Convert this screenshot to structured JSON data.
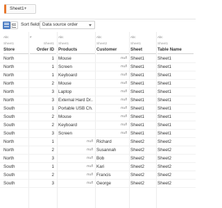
{
  "sheet_tab": {
    "label": "Sheet1+"
  },
  "toolbar": {
    "sort_label": "Sort fields",
    "sort_value": "Data source order"
  },
  "columns": [
    {
      "type_icon": "Abc",
      "source": "Sheet1",
      "name": "Store",
      "align": "left"
    },
    {
      "type_icon": "#",
      "source": "Sheet1",
      "name": "Order ID",
      "align": "right"
    },
    {
      "type_icon": "Abc",
      "source": "Sheet1",
      "name": "Products",
      "align": "left"
    },
    {
      "type_icon": "Abc",
      "source": "Sheet2",
      "name": "Customer",
      "align": "left"
    },
    {
      "type_icon": "Abc",
      "source": "Sheet1",
      "name": "Sheet",
      "align": "left"
    },
    {
      "type_icon": "Abc",
      "source": "Sheet1",
      "name": "Table Name",
      "align": "left"
    }
  ],
  "rows": [
    [
      "North",
      "1",
      "Mouse",
      "null",
      "Sheet1",
      "Sheet1"
    ],
    [
      "North",
      "1",
      "Screen",
      "null",
      "Sheet1",
      "Sheet1"
    ],
    [
      "North",
      "1",
      "Keyboard",
      "null",
      "Sheet1",
      "Sheet1"
    ],
    [
      "North",
      "2",
      "Mouse",
      "null",
      "Sheet1",
      "Sheet1"
    ],
    [
      "North",
      "3",
      "Laptop",
      "null",
      "Sheet1",
      "Sheet1"
    ],
    [
      "North",
      "3",
      "External Hard Dr...",
      "null",
      "Sheet1",
      "Sheet1"
    ],
    [
      "South",
      "1",
      "Portable USB Ch...",
      "null",
      "Sheet1",
      "Sheet1"
    ],
    [
      "South",
      "2",
      "Mouse",
      "null",
      "Sheet1",
      "Sheet1"
    ],
    [
      "South",
      "2",
      "Keyboard",
      "null",
      "Sheet1",
      "Sheet1"
    ],
    [
      "South",
      "3",
      "Screen",
      "null",
      "Sheet1",
      "Sheet1"
    ],
    [
      "North",
      "1",
      "null",
      "Richard",
      "Sheet2",
      "Sheet2"
    ],
    [
      "North",
      "2",
      "null",
      "Susannah",
      "Sheet2",
      "Sheet2"
    ],
    [
      "North",
      "3",
      "null",
      "Bob",
      "Sheet2",
      "Sheet2"
    ],
    [
      "South",
      "1",
      "null",
      "Kari",
      "Sheet2",
      "Sheet2"
    ],
    [
      "South",
      "2",
      "null",
      "Francis",
      "Sheet2",
      "Sheet2"
    ],
    [
      "South",
      "3",
      "null",
      "George",
      "Sheet2",
      "Sheet2"
    ]
  ]
}
